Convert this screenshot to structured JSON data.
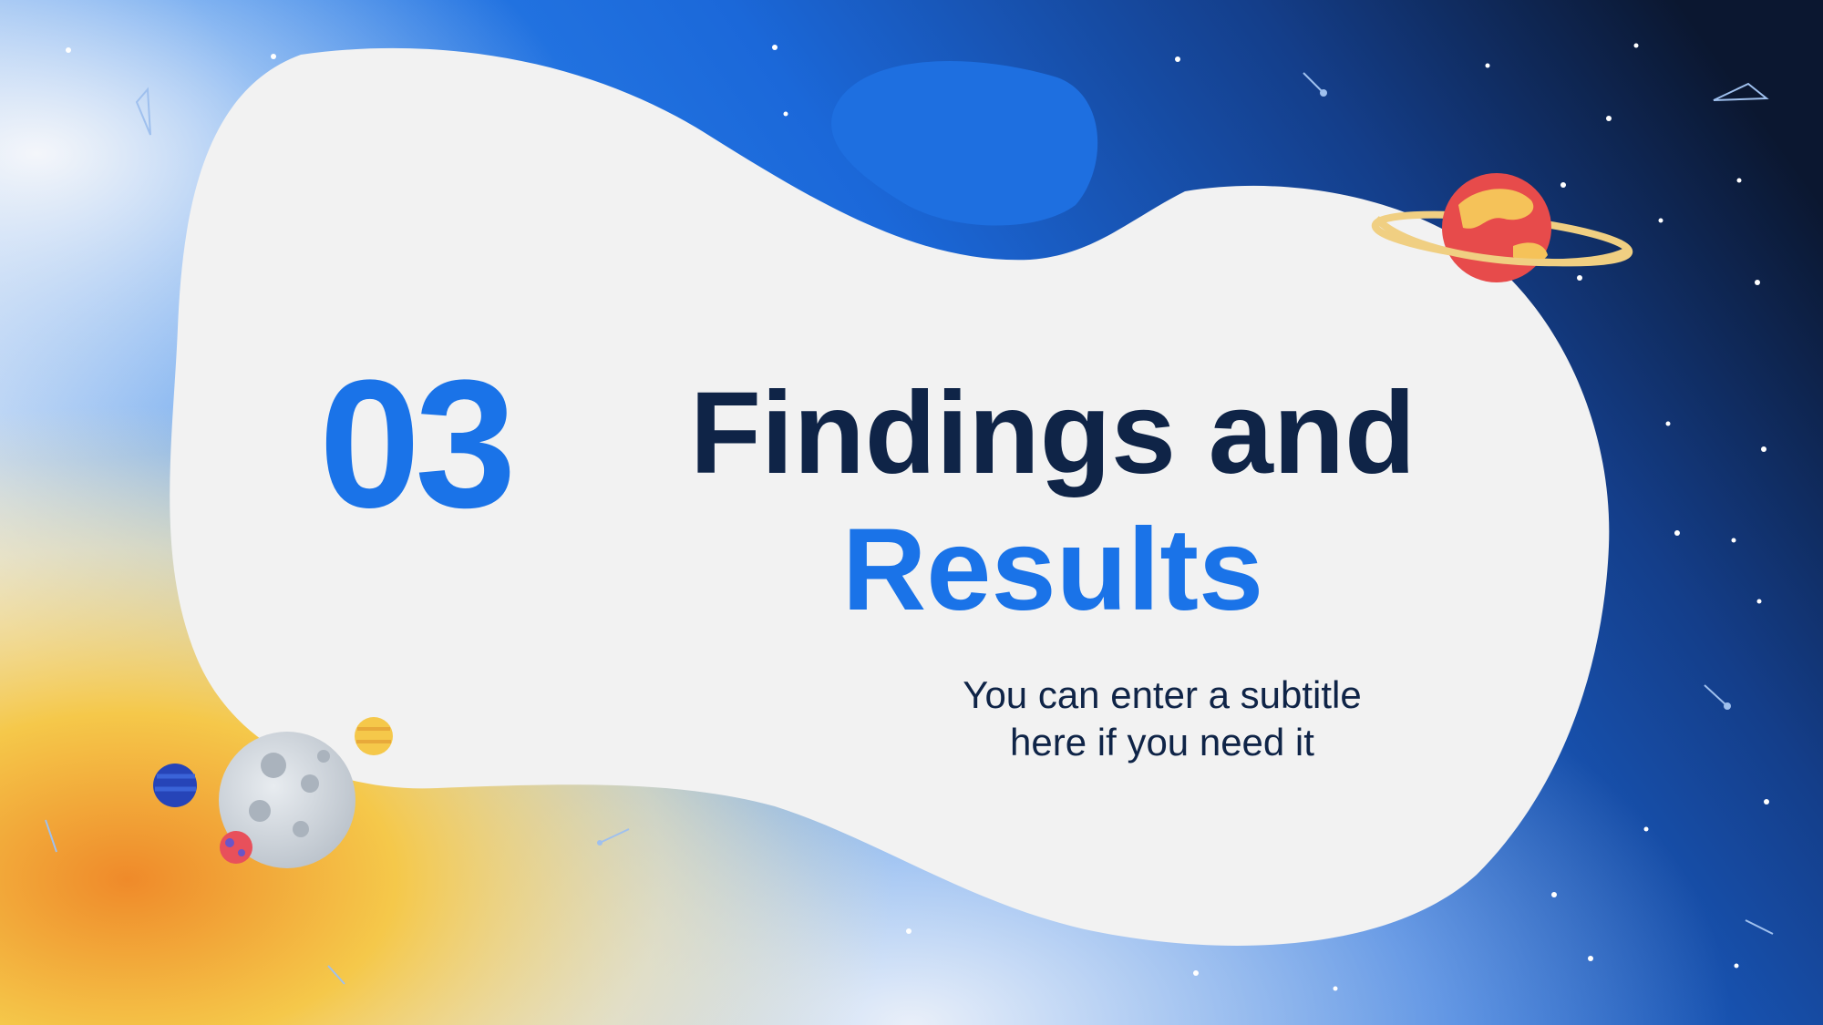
{
  "slide": {
    "number": "03",
    "title_line_1": "Findings and",
    "title_line_2": "Results",
    "subtitle_line_1": "You can enter a subtitle",
    "subtitle_line_2": "here if you need it"
  },
  "colors": {
    "accent_blue": "#1a73e8",
    "dark_navy": "#0f2447",
    "blob_fill": "#f2f2f2",
    "space_dark": "#0c1a38",
    "sun_yellow": "#f5c84a",
    "sun_orange": "#ef8a2a"
  },
  "decorations": {
    "planet_ringed": "ringed-planet-icon",
    "moon": "moon-icon",
    "planet_small_blue": "blue-planet-icon",
    "planet_small_yellow": "yellow-planet-icon",
    "planet_small_red": "red-planet-icon",
    "stars": "star-icon",
    "constellations": "constellation-icon"
  }
}
